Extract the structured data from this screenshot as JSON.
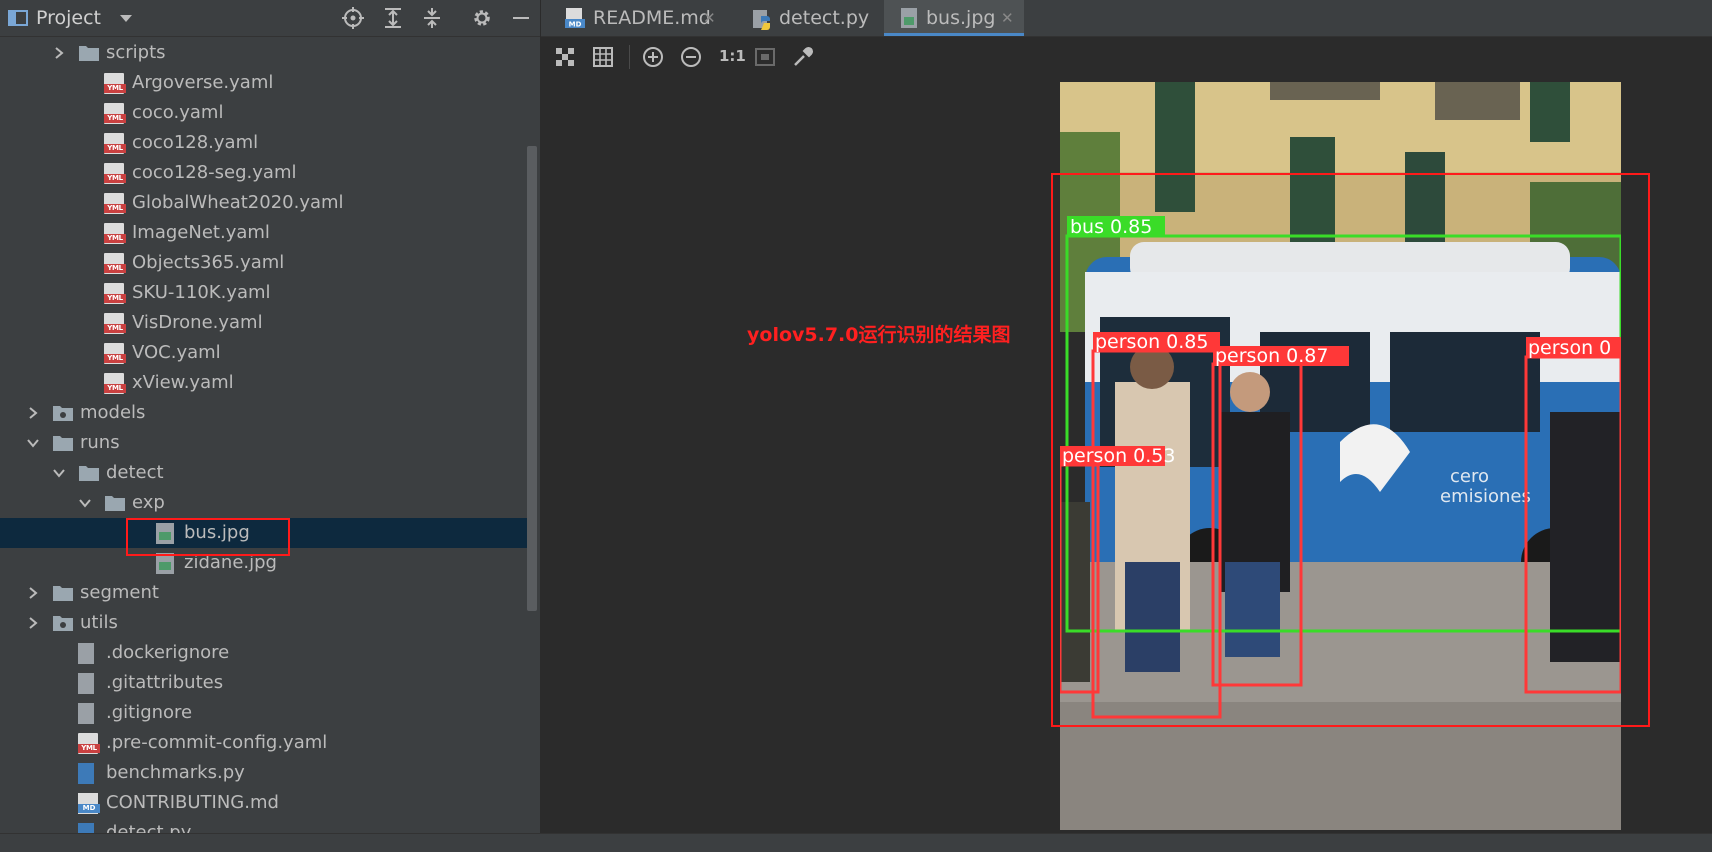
{
  "project": {
    "title": "Project",
    "icons": [
      "project-view-icon",
      "dropdown-arrow-icon",
      "locate-icon",
      "expand-all-icon",
      "collapse-all-icon",
      "gear-icon",
      "minimize-icon"
    ]
  },
  "tree": [
    {
      "label": "scripts",
      "type": "folder",
      "level": 1,
      "expanded": false
    },
    {
      "label": "Argoverse.yaml",
      "type": "yaml",
      "level": 2
    },
    {
      "label": "coco.yaml",
      "type": "yaml",
      "level": 2
    },
    {
      "label": "coco128.yaml",
      "type": "yaml",
      "level": 2
    },
    {
      "label": "coco128-seg.yaml",
      "type": "yaml",
      "level": 2
    },
    {
      "label": "GlobalWheat2020.yaml",
      "type": "yaml",
      "level": 2
    },
    {
      "label": "ImageNet.yaml",
      "type": "yaml",
      "level": 2
    },
    {
      "label": "Objects365.yaml",
      "type": "yaml",
      "level": 2
    },
    {
      "label": "SKU-110K.yaml",
      "type": "yaml",
      "level": 2
    },
    {
      "label": "VisDrone.yaml",
      "type": "yaml",
      "level": 2
    },
    {
      "label": "VOC.yaml",
      "type": "yaml",
      "level": 2
    },
    {
      "label": "xView.yaml",
      "type": "yaml",
      "level": 2
    },
    {
      "label": "models",
      "type": "package",
      "level": 0,
      "expanded": false
    },
    {
      "label": "runs",
      "type": "folder",
      "level": 0,
      "expanded": true
    },
    {
      "label": "detect",
      "type": "folder",
      "level": 1,
      "expanded": true
    },
    {
      "label": "exp",
      "type": "folder",
      "level": 2,
      "expanded": true
    },
    {
      "label": "bus.jpg",
      "type": "image",
      "level": 4,
      "selected": true
    },
    {
      "label": "zidane.jpg",
      "type": "image",
      "level": 4
    },
    {
      "label": "segment",
      "type": "folder",
      "level": 0,
      "expanded": false
    },
    {
      "label": "utils",
      "type": "package",
      "level": 0,
      "expanded": false
    },
    {
      "label": ".dockerignore",
      "type": "text",
      "level": 1
    },
    {
      "label": ".gitattributes",
      "type": "text",
      "level": 1
    },
    {
      "label": ".gitignore",
      "type": "text",
      "level": 1
    },
    {
      "label": ".pre-commit-config.yaml",
      "type": "yaml",
      "level": 1
    },
    {
      "label": "benchmarks.py",
      "type": "python",
      "level": 1
    },
    {
      "label": "CONTRIBUTING.md",
      "type": "markdown",
      "level": 1
    },
    {
      "label": "detect.py",
      "type": "python",
      "level": 1
    }
  ],
  "tabs": [
    {
      "label": "README.md",
      "icon": "markdown-file-icon",
      "active": false
    },
    {
      "label": "detect.py",
      "icon": "python-file-icon",
      "active": false
    },
    {
      "label": "bus.jpg",
      "icon": "image-file-icon",
      "active": true
    }
  ],
  "toolbar": {
    "icons": [
      "chessboard-icon",
      "grid-icon",
      "zoom-in-icon",
      "zoom-out-icon",
      "actual-size-icon",
      "fit-to-screen-icon",
      "color-picker-icon"
    ],
    "actual_size_label": "1:1"
  },
  "annotation": "yolov5.7.0运行识别的结果图",
  "detections": [
    {
      "label": "bus 0.85",
      "color": "#3adc28"
    },
    {
      "label": "person 0.85",
      "color": "#ff3838"
    },
    {
      "label": "person 0.87",
      "color": "#ff3838"
    },
    {
      "label": "person 0.53",
      "color": "#ff3838"
    },
    {
      "label": "person 0",
      "color": "#ff3838"
    }
  ],
  "colors": {
    "panel": "#3c3f41",
    "editor": "#2b2b2b",
    "selection": "#0d293e",
    "accent": "#4a88c7",
    "highlight": "#ff1a1a"
  }
}
